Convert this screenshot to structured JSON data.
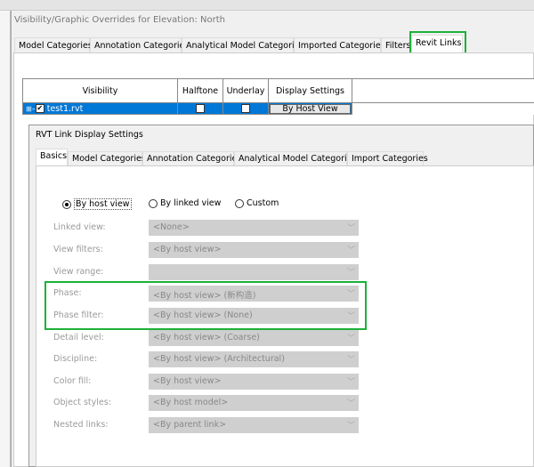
{
  "outer": {
    "title": "Visibility/Graphic Overrides for Elevation: North",
    "tabs": [
      "Model Categories",
      "Annotation Categories",
      "Analytical Model Categories",
      "Imported Categories",
      "Filters",
      "Revit Links"
    ],
    "table": {
      "headers": [
        "Visibility",
        "Halftone",
        "Underlay",
        "Display Settings"
      ],
      "row": {
        "name": "test1.rvt",
        "visible": true,
        "halftone": false,
        "underlay": false,
        "display": "By Host View"
      }
    }
  },
  "inner": {
    "title": "RVT Link Display Settings",
    "tabs": [
      "Basics",
      "Model Categories",
      "Annotation Categories",
      "Analytical Model Categories",
      "Import Categories"
    ],
    "radios": [
      "By host view",
      "By linked view",
      "Custom"
    ],
    "selected_radio": "By host view",
    "fields": [
      {
        "label": "Linked view:",
        "value": "<None>"
      },
      {
        "label": "View filters:",
        "value": "<By host view>"
      },
      {
        "label": "View range:",
        "value": ""
      },
      {
        "label": "Phase:",
        "value": "<By host view> (新构造)"
      },
      {
        "label": "Phase filter:",
        "value": "<By host view> (None)"
      },
      {
        "label": "Detail level:",
        "value": "<By host view> (Coarse)"
      },
      {
        "label": "Discipline:",
        "value": "<By host view> (Architectural)"
      },
      {
        "label": "Color fill:",
        "value": "<By host view>"
      },
      {
        "label": "Object styles:",
        "value": "<By host model>"
      },
      {
        "label": "Nested links:",
        "value": "<By parent link>"
      }
    ]
  },
  "colors": {
    "highlight": "#1db13a",
    "selection": "#0078d7"
  }
}
